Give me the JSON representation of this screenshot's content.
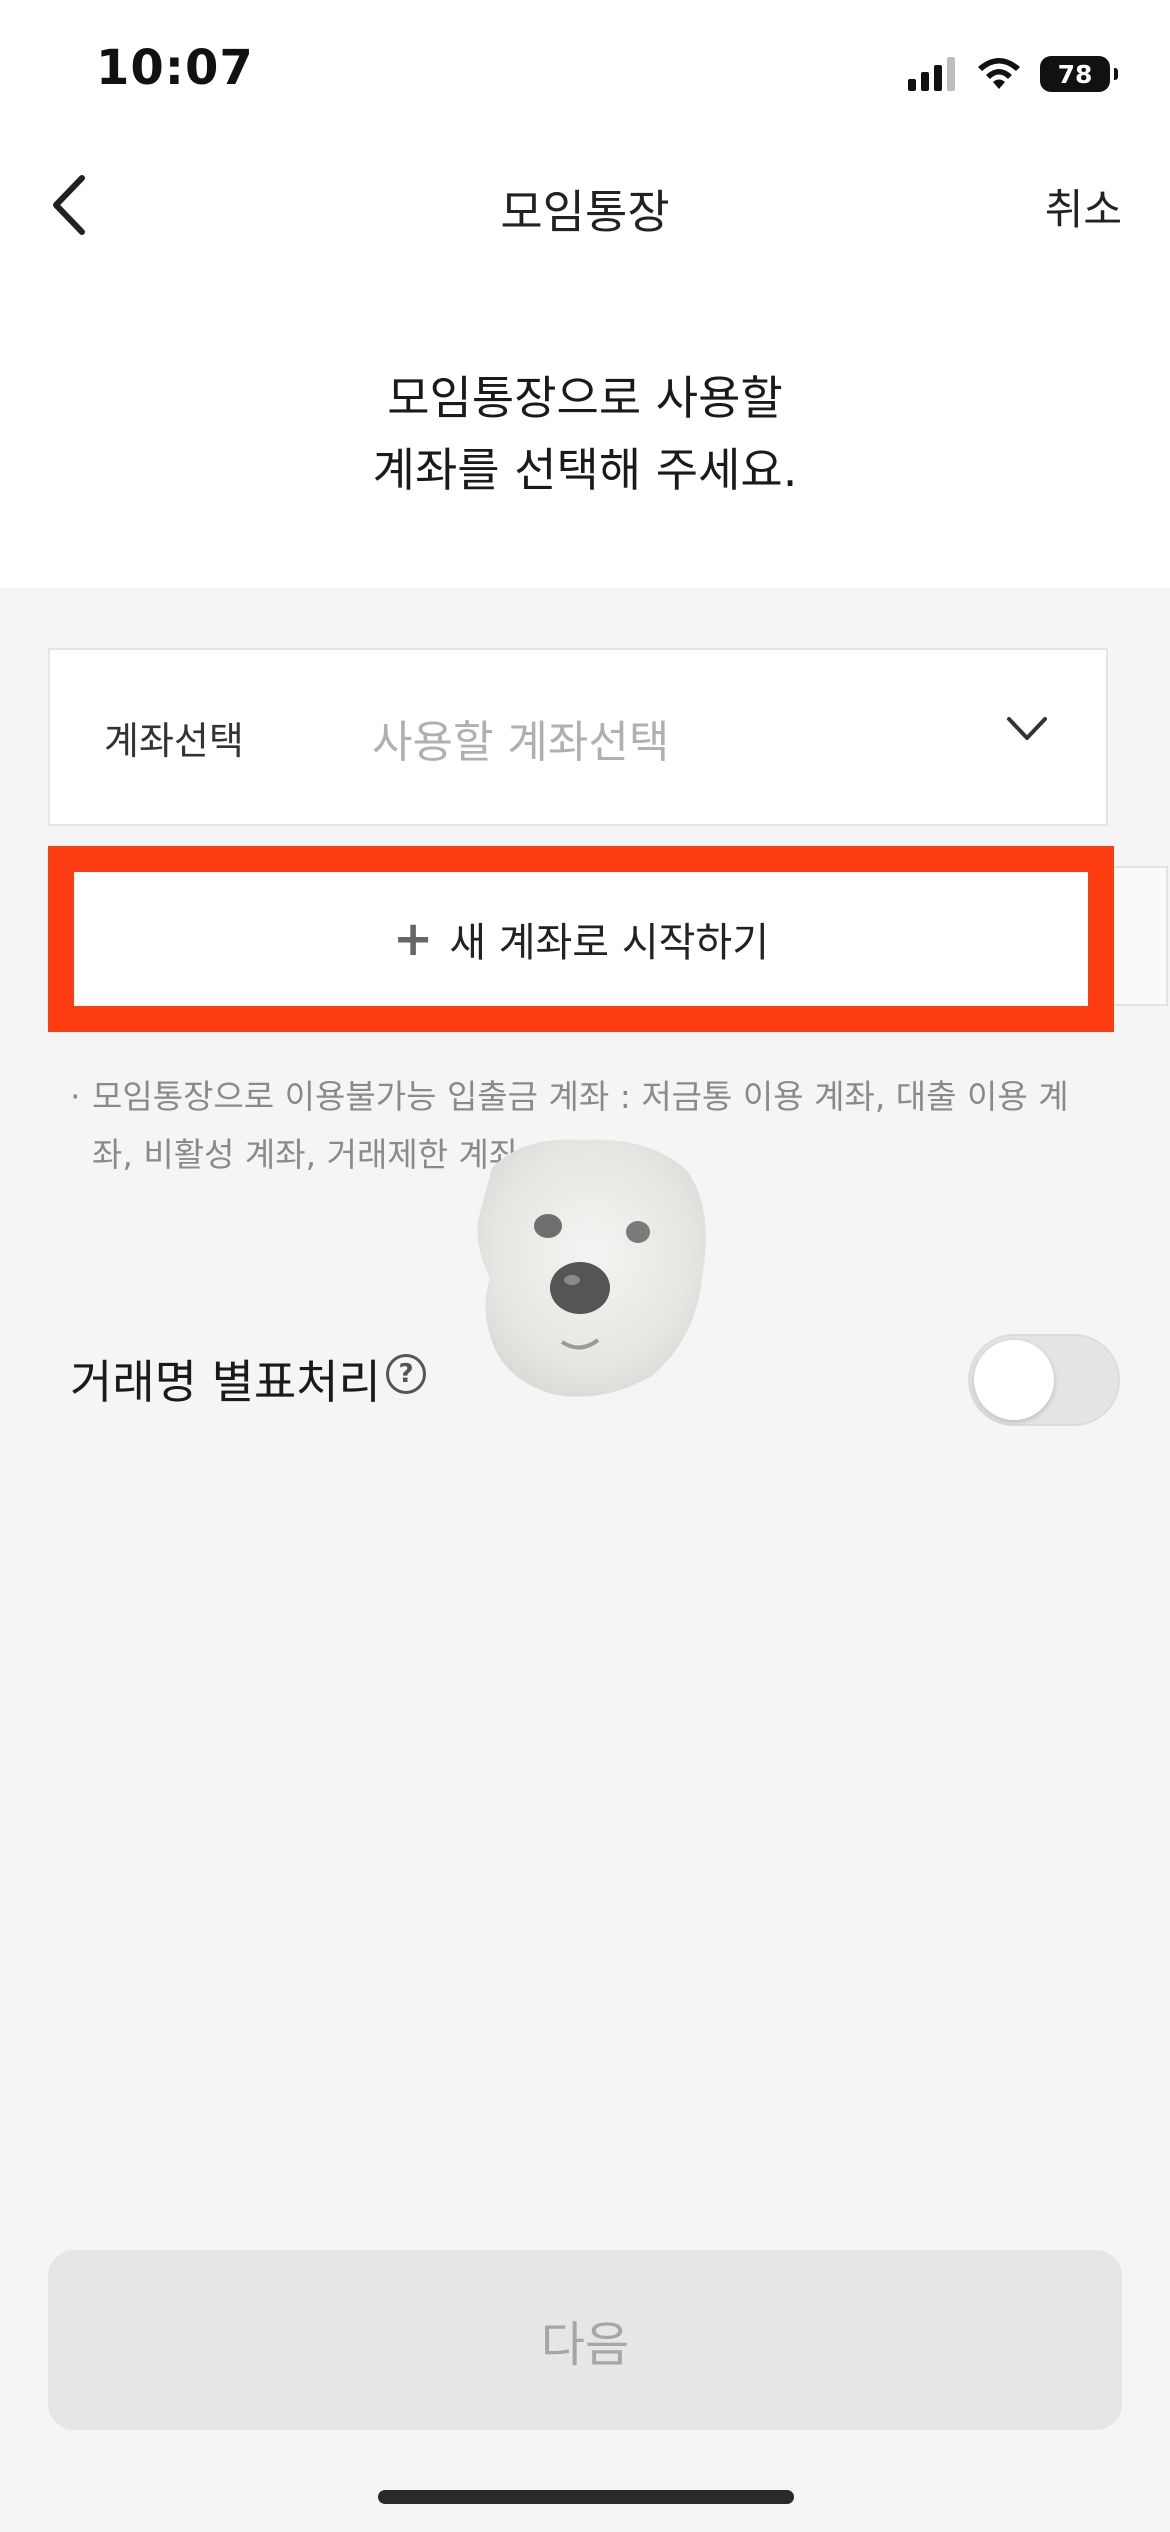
{
  "status_bar": {
    "time": "10:07",
    "battery": "78",
    "icons": [
      "signal-icon",
      "wifi-icon",
      "battery-icon"
    ]
  },
  "nav": {
    "back_icon": "chevron-left-icon",
    "title": "모임통장",
    "cancel_label": "취소"
  },
  "headline": {
    "line1": "모임통장으로 사용할",
    "line2": "계좌를 선택해 주세요."
  },
  "account_select": {
    "label": "계좌선택",
    "placeholder": "사용할 계좌선택",
    "icon": "chevron-down-icon"
  },
  "new_account": {
    "icon": "plus-icon",
    "label": "새 계좌로 시작하기",
    "highlight_color": "#ff3d12"
  },
  "notice": {
    "bullet": "·",
    "text": "모임통장으로 이용불가능 입출금 계좌 : 저금통 이용 계좌, 대출 이용 계좌, 비활성 계좌, 거래제한 계좌"
  },
  "sticker": {
    "icon": "dog-sticker"
  },
  "masking_option": {
    "label": "거래명 별표처리",
    "help_icon": "question-circle-icon",
    "help_glyph": "?",
    "toggle_state": "off"
  },
  "footer": {
    "next_label": "다음"
  }
}
